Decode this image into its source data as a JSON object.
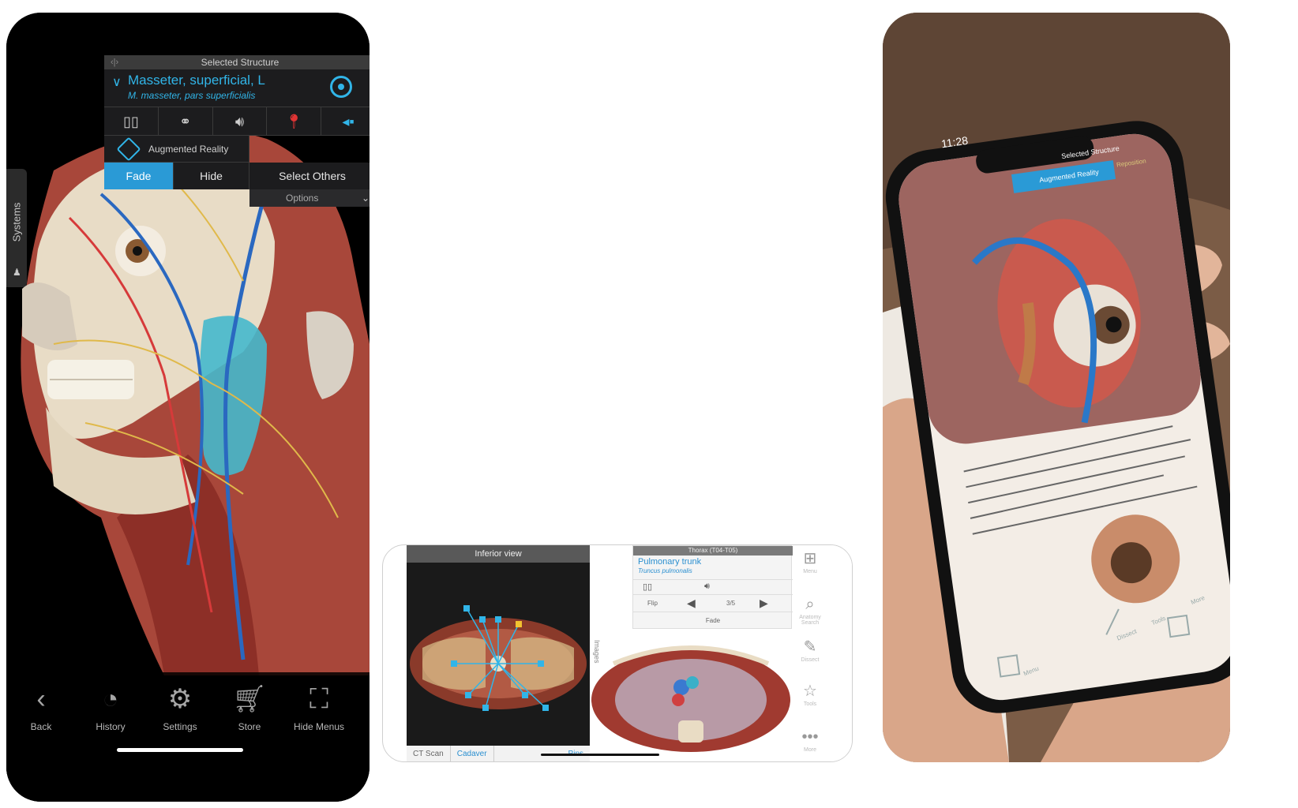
{
  "left_phone": {
    "panel": {
      "title": "Selected Structure",
      "structure_name": "Masseter, superficial, L",
      "structure_latin": "M. masseter, pars superficialis",
      "ar_label": "Augmented Reality",
      "fade": "Fade",
      "hide": "Hide",
      "select_others": "Select Others",
      "options": "Options"
    },
    "systems_tab": "Systems",
    "nav": [
      {
        "label": "Back",
        "icon": "back-chevron-icon"
      },
      {
        "label": "History",
        "icon": "history-icon"
      },
      {
        "label": "Settings",
        "icon": "gear-icon"
      },
      {
        "label": "Store",
        "icon": "cart-icon"
      },
      {
        "label": "Hide Menus",
        "icon": "hide-menus-icon"
      }
    ]
  },
  "tablet": {
    "inferior_view": "Inferior view",
    "ct_scan": "CT Scan",
    "cadaver": "Cadaver",
    "pins": "Pins",
    "images": "Images",
    "thorax_title": "Thorax (T04-T05)",
    "structure_name": "Pulmonary trunk",
    "structure_latin": "Truncus pulmonalis",
    "flip": "Flip",
    "page": "3/5",
    "fade": "Fade",
    "menu": [
      {
        "label": "Menu",
        "icon": "grid-icon"
      },
      {
        "label": "Anatomy Search",
        "icon": "search-icon"
      },
      {
        "label": "Dissect",
        "icon": "scalpel-icon"
      },
      {
        "label": "Tools",
        "icon": "tools-icon"
      },
      {
        "label": "More",
        "icon": "more-icon"
      }
    ]
  },
  "photo": {
    "time": "11:28",
    "selected_structure": "Selected Structure",
    "ar_label": "Augmented Reality",
    "reposition": "Reposition",
    "menu": "Menu",
    "dissect": "Dissect",
    "tools": "Tools",
    "more": "More"
  },
  "colors": {
    "accent_blue": "#2a9ad6",
    "highlight_blue": "#31b5e8",
    "dark_panel": "#1c1c1e"
  }
}
